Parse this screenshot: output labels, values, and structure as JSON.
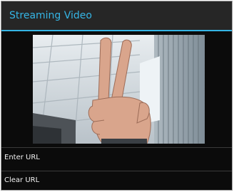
{
  "app": {
    "title": "Streaming Video",
    "accent_color": "#35b5e5",
    "background_color": "#0b0b0b"
  },
  "video": {
    "icon": "camera-feed"
  },
  "menu": {
    "items": [
      {
        "label": "Enter URL"
      },
      {
        "label": "Clear URL"
      }
    ]
  }
}
